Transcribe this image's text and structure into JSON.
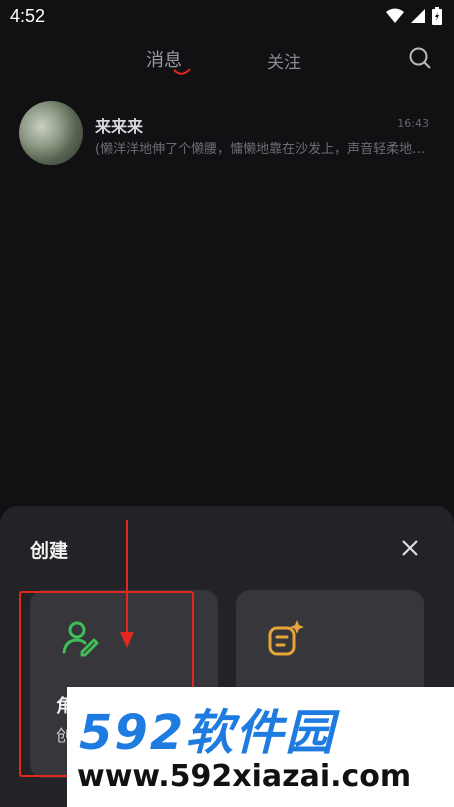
{
  "status": {
    "time": "4:52"
  },
  "nav": {
    "tab_messages": "消息",
    "tab_follow": "关注"
  },
  "conversation": {
    "name": "来来来",
    "time": "16:43",
    "preview": "(懒洋洋地伸了个懒腰，慵懒地靠在沙发上，声音轻柔地…"
  },
  "sheet": {
    "title": "创建",
    "card1_label": "角",
    "card1_sub": "创"
  },
  "watermark": {
    "brand": "592软件园",
    "url": "www.592xiazai.com"
  },
  "colors": {
    "accent_red": "#e0281e",
    "card_icon_green": "#3fbf55",
    "card_icon_orange": "#e8a53a",
    "watermark_blue": "#1e7be0"
  }
}
